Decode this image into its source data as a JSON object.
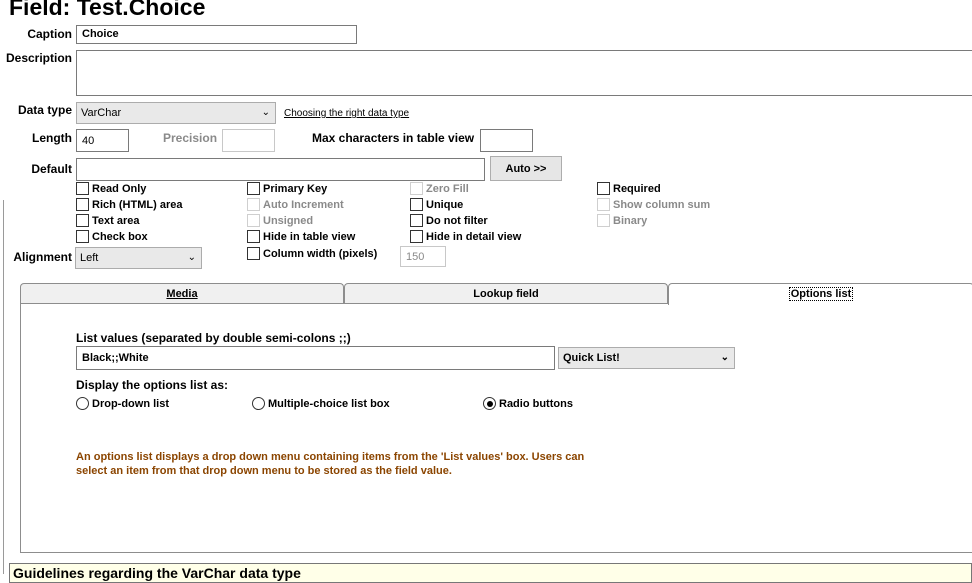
{
  "title": "Field: Test.Choice",
  "caption": {
    "label": "Caption",
    "value": "Choice"
  },
  "description": {
    "label": "Description",
    "value": ""
  },
  "data_type": {
    "label": "Data type",
    "value": "VarChar",
    "help_link": "Choosing the right data type"
  },
  "length": {
    "label": "Length",
    "value": "40"
  },
  "precision": {
    "label": "Precision",
    "value": ""
  },
  "max_chars": {
    "label": "Max characters in table view",
    "value": ""
  },
  "default": {
    "label": "Default",
    "value": "",
    "auto_button": "Auto >>"
  },
  "checkboxes": {
    "read_only": "Read Only",
    "rich_html": "Rich (HTML) area",
    "text_area": "Text area",
    "check_box": "Check box",
    "primary_key": "Primary Key",
    "auto_increment": "Auto Increment",
    "unsigned": "Unsigned",
    "hide_table_view": "Hide in table view",
    "column_width": "Column width (pixels)",
    "zero_fill": "Zero Fill",
    "unique": "Unique",
    "do_not_filter": "Do not filter",
    "hide_detail_view": "Hide in detail view",
    "required": "Required",
    "show_column_sum": "Show column sum",
    "binary": "Binary"
  },
  "column_width_value": "150",
  "alignment": {
    "label": "Alignment",
    "value": "Left"
  },
  "tabs": {
    "media": "Media",
    "lookup": "Lookup field",
    "options": "Options list"
  },
  "options": {
    "list_values_label": "List values (separated by double semi-colons ;;)",
    "list_values": "Black;;White",
    "quick_list": "Quick List!",
    "display_label": "Display the options list as:",
    "radio_dropdown": "Drop-down list",
    "radio_multiple": "Multiple-choice list box",
    "radio_buttons": "Radio buttons",
    "selected": "Radio buttons",
    "info_line1": "An options list displays a drop down menu containing items from the 'List values' box. Users can",
    "info_line2": "select an item from that drop down menu to be stored as the field value."
  },
  "footer": "Guidelines regarding the VarChar data type"
}
